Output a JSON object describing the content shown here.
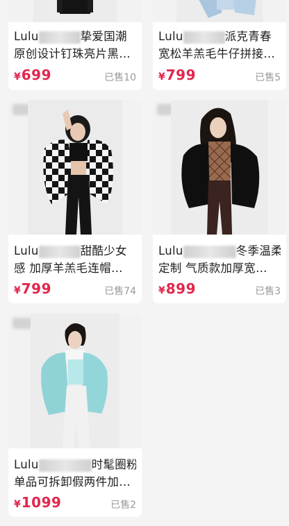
{
  "products": [
    {
      "title_prefix": "Lulu",
      "title_line1_suffix": "挚爱国潮",
      "title_line2": "原创设计钉珠亮片黑…",
      "currency": "¥",
      "price": "699",
      "sold": "已售10"
    },
    {
      "title_prefix": "Lulu",
      "title_line1_suffix": "派克青春",
      "title_line2": "宽松羊羔毛牛仔拼接…",
      "currency": "¥",
      "price": "799",
      "sold": "已售5"
    },
    {
      "title_prefix": "Lulu",
      "title_line1_suffix": "甜酷少女",
      "title_line2": "感 加厚羊羔毛连帽…",
      "currency": "¥",
      "price": "799",
      "sold": "已售74"
    },
    {
      "title_prefix": "Lulu",
      "title_line1_suffix": "冬季温柔",
      "title_line2": "定制 气质款加厚宽…",
      "currency": "¥",
      "price": "899",
      "sold": "已售3"
    },
    {
      "title_prefix": "Lulu",
      "title_line1_suffix": "时髦圈粉",
      "title_line2": "单品可拆卸假两件加…",
      "currency": "¥",
      "price": "1099",
      "sold": "已售2"
    }
  ],
  "colors": {
    "price": "#e2264d",
    "sold": "#9a9a9a",
    "background": "#f4f4f4",
    "card": "#ffffff"
  }
}
